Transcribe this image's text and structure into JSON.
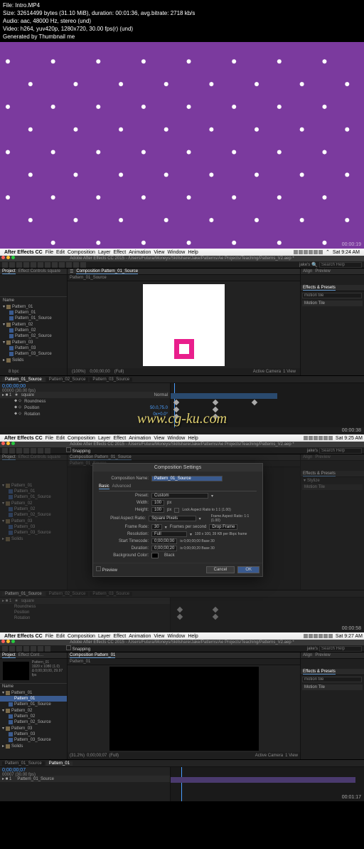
{
  "file_info": {
    "l1": "File: Intro.MP4",
    "l2": "Size: 32614499 bytes (31.10 MiB), duration: 00:01:36, avg.bitrate: 2718 kb/s",
    "l3": "Audio: aac, 48000 Hz, stereo (und)",
    "l4": "Video: h264, yuv420p, 1280x720, 30.00 fps(r) (und)",
    "l5": "Generated by Thumbnail me"
  },
  "timestamps": {
    "t1": "00:00:19",
    "t2": "00:00:38",
    "t3": "00:00:58",
    "t4": "00:01:17"
  },
  "menubar": {
    "apple": "",
    "app": "After Effects CC",
    "items": [
      "File",
      "Edit",
      "Composition",
      "Layer",
      "Effect",
      "Animation",
      "View",
      "Window",
      "Help"
    ],
    "workspace": "jake's",
    "wifi": "",
    "clock": "Sat 9:24 AM",
    "clock2": "Sat 9:25 AM",
    "clock3": "Sat 9:27 AM",
    "user": ""
  },
  "titlebar": "Adobe After Effects CC 2015 - /Users/Futura/Moneys/Skillshare/Jake/Patterns/Ae Projects/Teaching/Patterns_V2.aep *",
  "project_panel": {
    "title": "Project",
    "ec": "Effect Controls square"
  },
  "comp": {
    "tab": "Composition",
    "name": "Pattern_01_Source",
    "tab_label": "Pattern_01_Source",
    "zoom": "(100%)",
    "zoom3": "(31.2%)",
    "tc": "0;00;00;00",
    "res": "(Full)",
    "view": "Active Camera",
    "nview": "1 View"
  },
  "effects": {
    "title": "Effects & Presets",
    "search": "motion tile",
    "item": "Motion Tile",
    "align": "Align",
    "preview": "Preview",
    "stylize": "Stylize"
  },
  "project_items": {
    "folders": [
      "Pattern_01",
      "Pattern_02",
      "Pattern_03"
    ],
    "comps": [
      "Pattern_01",
      "Pattern_01_Source",
      "Pattern_02",
      "Pattern_02_Source",
      "Pattern_03",
      "Pattern_03_Source",
      "Solids"
    ]
  },
  "timeline": {
    "tabs": [
      "Pattern_01_Source",
      "Pattern_02_Source",
      "Pattern_03_Source"
    ],
    "tc": "0;00;00;00",
    "tc_sub": "00000 (30.00 fps)",
    "tc2": "0;00;00;07",
    "tc2_sub": "00007 (30.00 fps)",
    "layer": "square",
    "mode": "Normal",
    "props": [
      "Roundness",
      "Position",
      "Rotation"
    ],
    "vals": [
      "",
      "50.0,75.0",
      "0x+0.0°"
    ]
  },
  "watermark": "www.cg-ku.com",
  "dialog": {
    "title": "Composition Settings",
    "name_lbl": "Composition Name:",
    "name_val": "Pattern_01_Source",
    "tabs": [
      "Basic",
      "Advanced"
    ],
    "preset_lbl": "Preset:",
    "preset_val": "Custom",
    "width_lbl": "Width:",
    "width_val": "100",
    "px": "px",
    "height_lbl": "Height:",
    "height_val": "100",
    "lock_aspect": "Lock Aspect Ratio to 1:1 (1.00)",
    "par_lbl": "Pixel Aspect Ratio:",
    "par_val": "Square Pixels",
    "far_lbl": "Frame Aspect Ratio:\n1:1 (1.00)",
    "fr_lbl": "Frame Rate:",
    "fr_val": "30",
    "fps": "Frames per second",
    "drop": "Drop Frame",
    "res_lbl": "Resolution:",
    "res_val": "Full",
    "res_info": "100 x 100, 39 KB per 8bpc frame",
    "start_lbl": "Start Timecode:",
    "start_val": "0;00;00;00",
    "start_info": "is 0;00;00;00 Base 30",
    "dur_lbl": "Duration:",
    "dur_val": "0;00;00;20",
    "dur_info": "is 0;00;00;20 Base 30",
    "bg_lbl": "Background Color:",
    "bg_val": "Black",
    "preview": "Preview",
    "cancel": "Cancel",
    "ok": "OK"
  },
  "snapping": "Snapping",
  "search_help": "Search Help",
  "bpc": "8 bpc",
  "comp_info": {
    "res": "1920 x 1080 (1.0)",
    "dur": "Δ 0;00;30;00, 29.97 fps"
  },
  "name_col": "Name"
}
